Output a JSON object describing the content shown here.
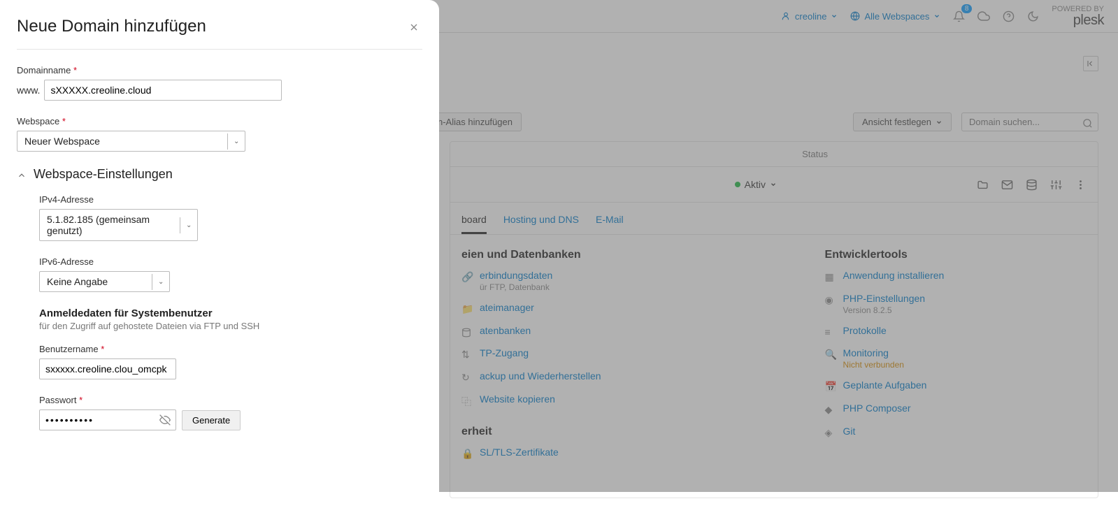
{
  "topbar": {
    "user": "creoline",
    "webspaces": "Alle Webspaces",
    "notif_count": "8",
    "powered": "POWERED BY",
    "brand": "plesk"
  },
  "toolbar": {
    "alias_btn": "n-Alias hinzufügen",
    "view_btn": "Ansicht festlegen",
    "search_placeholder": "Domain suchen..."
  },
  "card": {
    "status_header": "Status",
    "status_value": "Aktiv",
    "tabs": {
      "dashboard": "board",
      "hosting": "Hosting und DNS",
      "email": "E-Mail"
    }
  },
  "filesdb": {
    "title": "eien und Datenbanken",
    "connection": {
      "label": "erbindungsdaten",
      "sub": "ür FTP, Datenbank"
    },
    "filemanager": "ateimanager",
    "databases": "atenbanken",
    "ftp": "TP-Zugang",
    "backup": "ackup und Wiederherstellen",
    "copy": "Website kopieren"
  },
  "security": {
    "title": "erheit",
    "ssl": "SL/TLS-Zertifikate"
  },
  "devtools": {
    "title": "Entwicklertools",
    "install": "Anwendung installieren",
    "php": {
      "label": "PHP-Einstellungen",
      "sub": "Version 8.2.5"
    },
    "logs": "Protokolle",
    "monitoring": {
      "label": "Monitoring",
      "sub": "Nicht verbunden"
    },
    "scheduled": "Geplante Aufgaben",
    "composer": "PHP Composer",
    "git": "Git"
  },
  "modal": {
    "title": "Neue Domain hinzufügen",
    "domain_label": "Domainname",
    "www": "www.",
    "domain_value": "sXXXXX.creoline.cloud",
    "webspace_label": "Webspace",
    "webspace_value": "Neuer Webspace",
    "sec_title": "Webspace-Einstellungen",
    "ipv4_label": "IPv4-Adresse",
    "ipv4_value": "5.1.82.185 (gemeinsam genutzt)",
    "ipv6_label": "IPv6-Adresse",
    "ipv6_value": "Keine Angabe",
    "creds_title": "Anmeldedaten für Systembenutzer",
    "creds_desc": "für den Zugriff auf gehostete Dateien via FTP und SSH",
    "user_label": "Benutzername",
    "user_value": "sxxxxx.creoline.clou_omcpk",
    "pw_label": "Passwort",
    "pw_value": "••••••••••",
    "generate": "Generate"
  }
}
